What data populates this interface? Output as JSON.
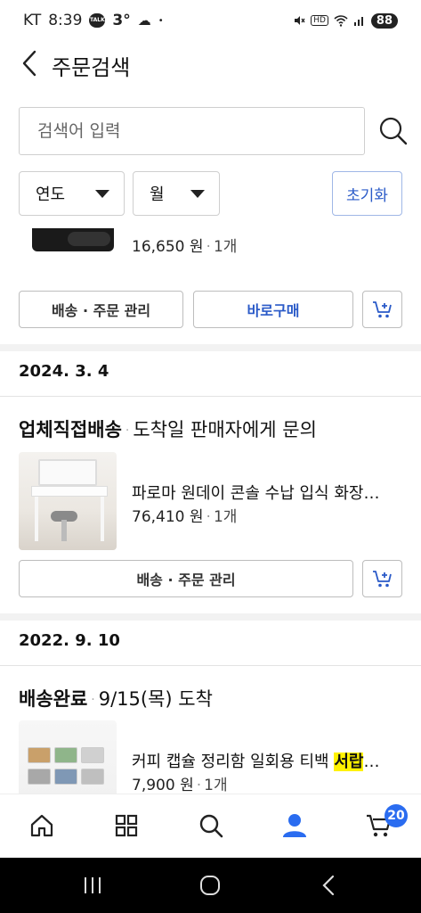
{
  "status_bar": {
    "carrier": "KT",
    "time": "8:39",
    "talk_icon_text": "TALK",
    "temperature": "3°",
    "weather_icon": "cloud-icon",
    "dot": "•",
    "hd_label": "HD",
    "battery": "88"
  },
  "header": {
    "title": "주문검색",
    "back_icon": "chevron-left-icon"
  },
  "search": {
    "placeholder": "검색어 입력",
    "value": "",
    "icon": "search-icon"
  },
  "filters": {
    "year_label": "연도",
    "month_label": "월",
    "reset_label": "초기화"
  },
  "orders": [
    {
      "price": "16,650 원",
      "qty": "1개",
      "manage_label": "배송 · 주문 관리",
      "buy_now_label": "바로구매"
    },
    {
      "date": "2024. 3. 4",
      "status": "업체직접배송",
      "status_detail": "도착일 판매자에게 문의",
      "product_name": "파로마 원데이 콘솔 수납 입식 화장…",
      "price": "76,410 원",
      "qty": "1개",
      "manage_label": "배송 · 주문 관리"
    },
    {
      "date": "2022. 9. 10",
      "status": "배송완료",
      "status_detail": "9/15(목) 도착",
      "product_name_prefix": "커피 캡슐 정리함 일회용 티백 ",
      "product_name_highlight": "서랍",
      "product_name_suffix": "…",
      "price": "7,900 원",
      "qty": "1개"
    }
  ],
  "bottom_nav": {
    "items": [
      "home-icon",
      "grid-icon",
      "search-icon",
      "profile-icon",
      "cart-icon"
    ],
    "cart_count": "20",
    "active": "profile-icon"
  },
  "colors": {
    "accent": "#2a5ac8",
    "badge": "#2a6cf0",
    "highlight": "#fff200"
  }
}
